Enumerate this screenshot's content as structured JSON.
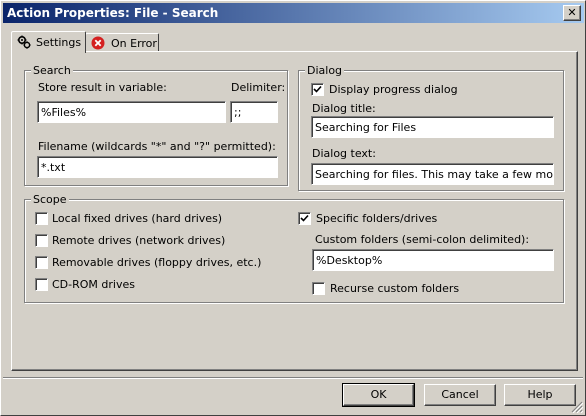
{
  "window": {
    "title": "Action Properties: File - Search",
    "close_glyph": "✕"
  },
  "tabs": [
    {
      "label": "Settings",
      "icon": "settings-gear-icon",
      "active": true
    },
    {
      "label": "On Error",
      "icon": "error-icon",
      "active": false
    }
  ],
  "search": {
    "group_label": "Search",
    "store_label": "Store result in variable:",
    "store_value": "%Files%",
    "delimiter_label": "Delimiter:",
    "delimiter_value": ";;",
    "filename_label": "Filename (wildcards \"*\" and \"?\" permitted):",
    "filename_value": "*.txt"
  },
  "dialog": {
    "group_label": "Dialog",
    "display_progress_label": "Display progress dialog",
    "display_progress_checked": true,
    "title_label": "Dialog title:",
    "title_value": "Searching for Files",
    "text_label": "Dialog text:",
    "text_value": "Searching for files.  This may take a few moments."
  },
  "scope": {
    "group_label": "Scope",
    "options": [
      {
        "label": "Local fixed drives (hard drives)",
        "checked": false
      },
      {
        "label": "Remote drives (network drives)",
        "checked": false
      },
      {
        "label": "Removable drives (floppy drives, etc.)",
        "checked": false
      },
      {
        "label": "CD-ROM drives",
        "checked": false
      }
    ],
    "specific_label": "Specific folders/drives",
    "specific_checked": true,
    "custom_label": "Custom folders (semi-colon delimited):",
    "custom_value": "%Desktop%",
    "recurse_label": "Recurse custom folders",
    "recurse_checked": false
  },
  "buttons": {
    "ok": "OK",
    "cancel": "Cancel",
    "help": "Help"
  },
  "colors": {
    "titlebar_start": "#0a246a",
    "titlebar_end": "#a6caf0",
    "face": "#d4d0c8",
    "error_red": "#d42020"
  }
}
